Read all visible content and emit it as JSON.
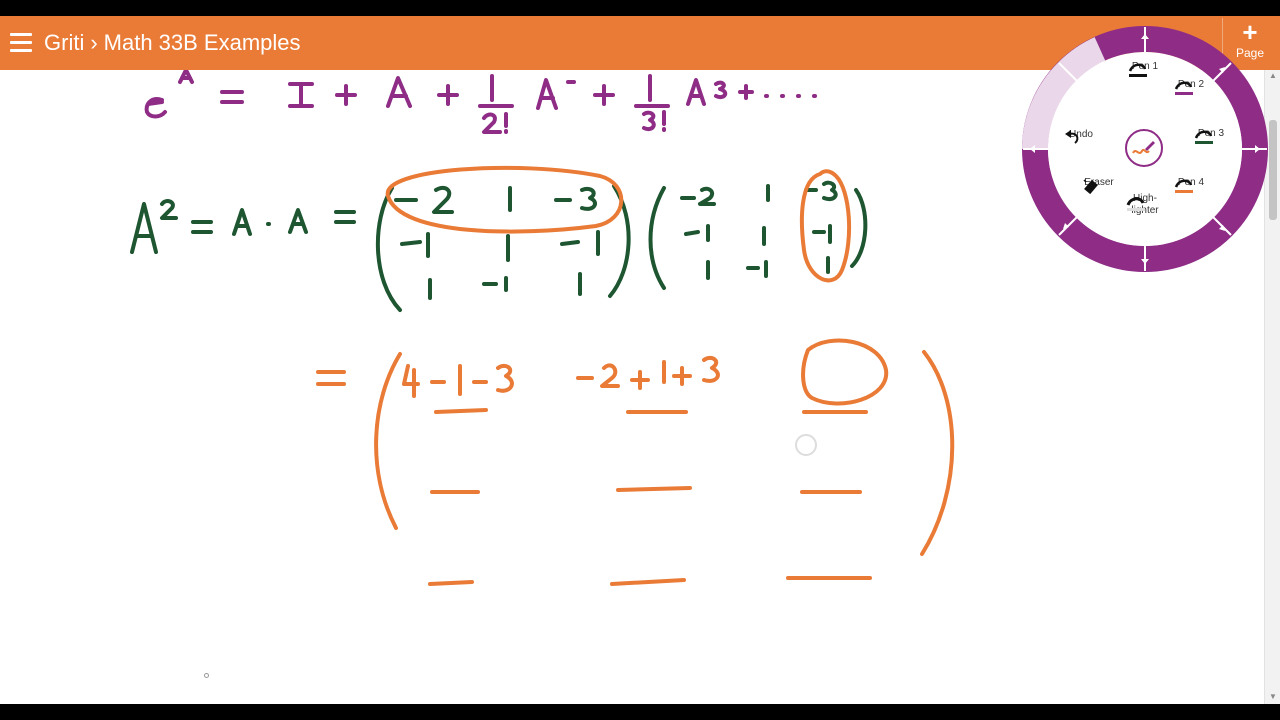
{
  "app": {
    "breadcrumb": {
      "notebook": "Griti",
      "separator": "›",
      "page": "Math 33B Examples"
    },
    "add_page": {
      "icon": "plus-icon",
      "label": "Page"
    },
    "menu_icon": "hamburger-menu-icon",
    "accent_color": "#E97B37"
  },
  "radial_menu": {
    "ring_color": "#8E2C86",
    "highlight_color": "#EBD7EA",
    "center_icon": "pen-squiggle-icon",
    "tools": [
      {
        "name": "pen-1",
        "label": "Pen 1",
        "color": "#111111"
      },
      {
        "name": "pen-2",
        "label": "Pen 2",
        "color": "#8E2C86"
      },
      {
        "name": "pen-3",
        "label": "Pen 3",
        "color": "#1E5631"
      },
      {
        "name": "pen-4",
        "label": "Pen 4",
        "color": "#E97B37"
      },
      {
        "name": "undo",
        "label": "Undo",
        "icon": "undo-icon"
      },
      {
        "name": "eraser",
        "label": "Eraser",
        "icon": "eraser-icon"
      },
      {
        "name": "highlighter",
        "label": "High-\nlighter",
        "color": "#dddddd"
      }
    ]
  },
  "ink_colors": {
    "purple": "#8E2C86",
    "green": "#1E5631",
    "orange": "#E97B37"
  }
}
